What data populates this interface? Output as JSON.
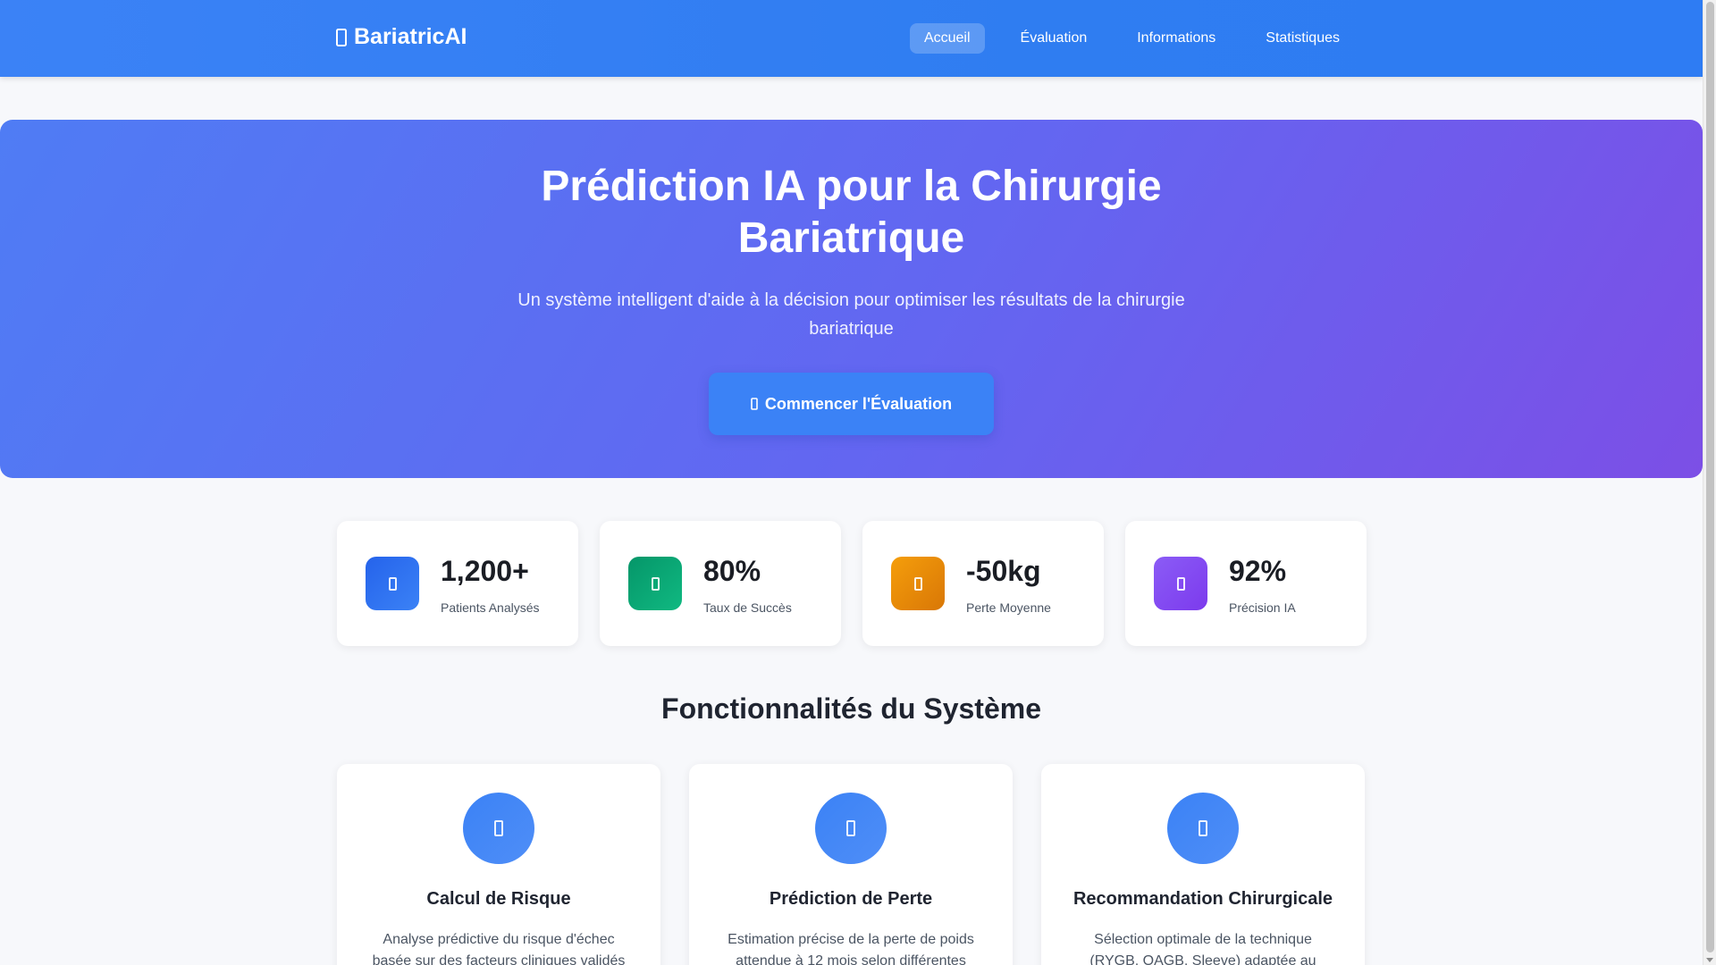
{
  "navbar": {
    "brand": "BariatricAI",
    "brand_icon": "brain-icon",
    "links": [
      {
        "label": "Accueil",
        "active": true
      },
      {
        "label": "Évaluation",
        "active": false
      },
      {
        "label": "Informations",
        "active": false
      },
      {
        "label": "Statistiques",
        "active": false
      }
    ]
  },
  "hero": {
    "title_line1": "Prédiction IA pour la Chirurgie",
    "title_line2": "Bariatrique",
    "subtitle_line1": "Un système intelligent d'aide à la décision pour optimiser les résultats de la chirurgie",
    "subtitle_line2": "bariatrique",
    "cta_label": "Commencer l'Évaluation",
    "cta_icon": "play-icon"
  },
  "stats": [
    {
      "value": "1,200+",
      "label": "Patients Analysés",
      "icon": "users-icon",
      "color": "#2563eb"
    },
    {
      "value": "80%",
      "label": "Taux de Succès",
      "icon": "chart-icon",
      "color": "#10a37f"
    },
    {
      "value": "-50kg",
      "label": "Perte Moyenne",
      "icon": "weight-icon",
      "color": "#e38a0b"
    },
    {
      "value": "92%",
      "label": "Précision IA",
      "icon": "robot-icon",
      "color": "#7c3aed"
    }
  ],
  "features": {
    "title": "Fonctionnalités du Système",
    "items": [
      {
        "title": "Calcul de Risque",
        "desc_line1": "Analyse prédictive du risque d'échec",
        "desc_line2": "basée sur des facteurs cliniques validés",
        "icon": "calculator-icon"
      },
      {
        "title": "Prédiction de Perte",
        "desc_line1": "Estimation précise de la perte de poids",
        "desc_line2": "attendue à 12 mois selon différentes",
        "icon": "chart-line-icon"
      },
      {
        "title": "Recommandation Chirurgicale",
        "desc_line1": "Sélection optimale de la technique",
        "desc_line2": "(RYGB, OAGB, Sleeve) adaptée au profil",
        "icon": "stethoscope-icon"
      }
    ]
  },
  "colors": {
    "primary": "#3b82f6",
    "hero_start": "#4f7cf4",
    "hero_end": "#7c4fe6"
  }
}
